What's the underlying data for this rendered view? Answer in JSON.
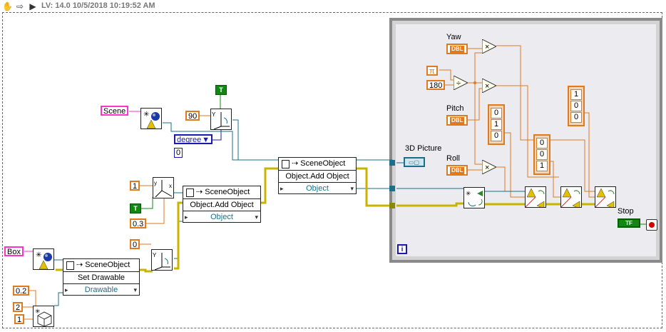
{
  "toolbar": {
    "lv_info": "LV: 14.0 10/5/2018 10:19:52 AM",
    "icons": [
      "hand-icon",
      "arrow-icon",
      "run-icon"
    ]
  },
  "constants": {
    "scene": "Scene",
    "box": "Box",
    "angle_90": "90",
    "degree": "degree",
    "zero_a": "0",
    "one": "1",
    "bool_true_a": "T",
    "bool_true_b": "T",
    "point3": "0.3",
    "zero_b": "0",
    "point2": "0.2",
    "two": "2",
    "one_b": "1",
    "pi": "π",
    "one_eighty": "180"
  },
  "nodes": {
    "obj_add_1": {
      "class": "SceneObject",
      "method": "Object.Add Object",
      "param": "Object"
    },
    "obj_add_2": {
      "class": "SceneObject",
      "method": "Object.Add Object",
      "param": "Object"
    },
    "set_drawable": {
      "class": "SceneObject",
      "method": "Set Drawable",
      "param": "Drawable"
    }
  },
  "loop": {
    "yaw_label": "Yaw",
    "pitch_label": "Pitch",
    "roll_label": "Roll",
    "dbl_tag": "DBL",
    "picture_label": "3D Picture",
    "stop_label": "Stop",
    "stop_tag": "TF",
    "iteration": "i",
    "array_010": [
      "0",
      "1",
      "0"
    ],
    "array_001": [
      "0",
      "0",
      "1"
    ],
    "array_100": [
      "1",
      "0",
      "0"
    ]
  },
  "colors": {
    "numeric_wire": "#e07a1f",
    "refnum_wire": "#1a6f8a",
    "error_wire": "#c8b400",
    "bool": "#118811",
    "string": "#ff33cc",
    "enum": "#1a1ab0"
  }
}
